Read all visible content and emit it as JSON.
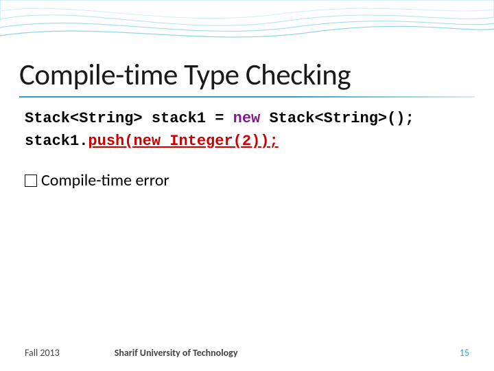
{
  "title": "Compile-time Type Checking",
  "code": {
    "line1": {
      "p1": "Stack<String> stack1 = ",
      "kw1": "new",
      "p2": " Stack<String>();"
    },
    "line2": {
      "p1": "stack1.",
      "err1": "push(",
      "kw1": "new",
      "err2": " Integer(2));"
    }
  },
  "bullet": "Compile-time error",
  "footer": {
    "left": "Fall 2013",
    "center": "Sharif University of Technology",
    "page": "15"
  }
}
